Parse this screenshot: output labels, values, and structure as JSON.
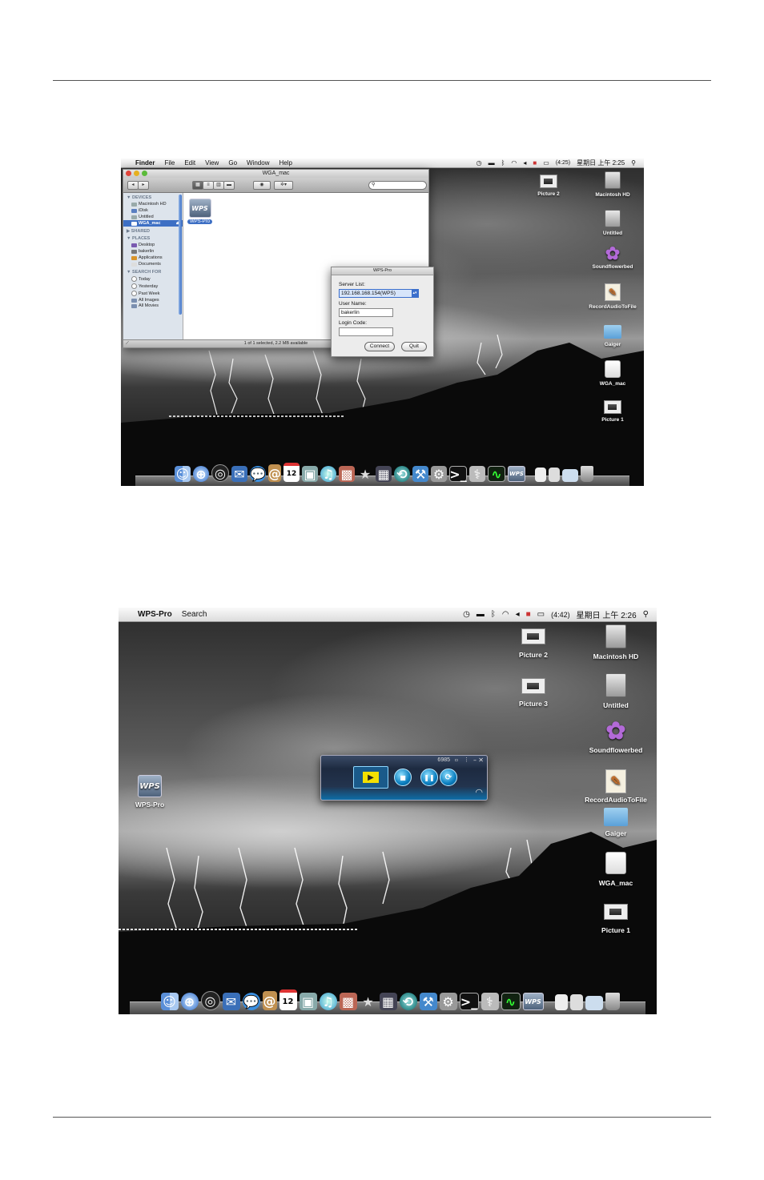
{
  "shot1": {
    "menubar": {
      "apple": "",
      "app": "Finder",
      "menus": [
        "File",
        "Edit",
        "View",
        "Go",
        "Window",
        "Help"
      ],
      "battery": "(4:25)",
      "clock": "星期日 上午 2:25"
    },
    "finder": {
      "title": "WGA_mac",
      "sidebar": {
        "devices_header": "▼ DEVICES",
        "devices": [
          "Macintosh HD",
          "iDisk",
          "Untitled",
          "WGA_mac"
        ],
        "shared_header": "▶ SHARED",
        "places_header": "▼ PLACES",
        "places": [
          "Desktop",
          "bakerlin",
          "Applications",
          "Documents"
        ],
        "search_header": "▼ SEARCH FOR",
        "search": [
          "Today",
          "Yesterday",
          "Past Week",
          "All Images",
          "All Movies"
        ]
      },
      "file_icon": "WPS",
      "file_label": "WPS-Pro",
      "status": "1 of 1 selected, 2.2 MB available"
    },
    "dialog": {
      "title": "WPS-Pro",
      "server_list_label": "Server List:",
      "server_value": "192.168.168.154(WPS)",
      "user_label": "User Name:",
      "user_value": "bakerlin",
      "code_label": "Login Code:",
      "code_value": "",
      "connect": "Connect",
      "quit": "Quit"
    },
    "desktop_icons": [
      "Picture 2",
      "Macintosh HD",
      "Untitled",
      "Soundflowerbed",
      "RecordAudioToFile",
      "Gaiger",
      "WGA_mac",
      "Picture 1"
    ]
  },
  "shot2": {
    "menubar": {
      "apple": "",
      "app": "WPS-Pro",
      "menus": [
        "Search"
      ],
      "battery": "(4:42)",
      "clock": "星期日 上午 2:26"
    },
    "desktop_icons": [
      "Picture 2",
      "Macintosh HD",
      "Picture 3",
      "Untitled",
      "Soundflowerbed",
      "RecordAudioToFile",
      "Gaiger",
      "WGA_mac",
      "Picture 1"
    ],
    "wps_icon": "WPS",
    "wps_label": "WPS-Pro",
    "player": {
      "code": "6985"
    }
  },
  "dock": {
    "calendar_day": "12",
    "wps": "WPS"
  },
  "colors": {
    "selection": "#3d6fc4",
    "player_accent": "#0b7fc0"
  }
}
